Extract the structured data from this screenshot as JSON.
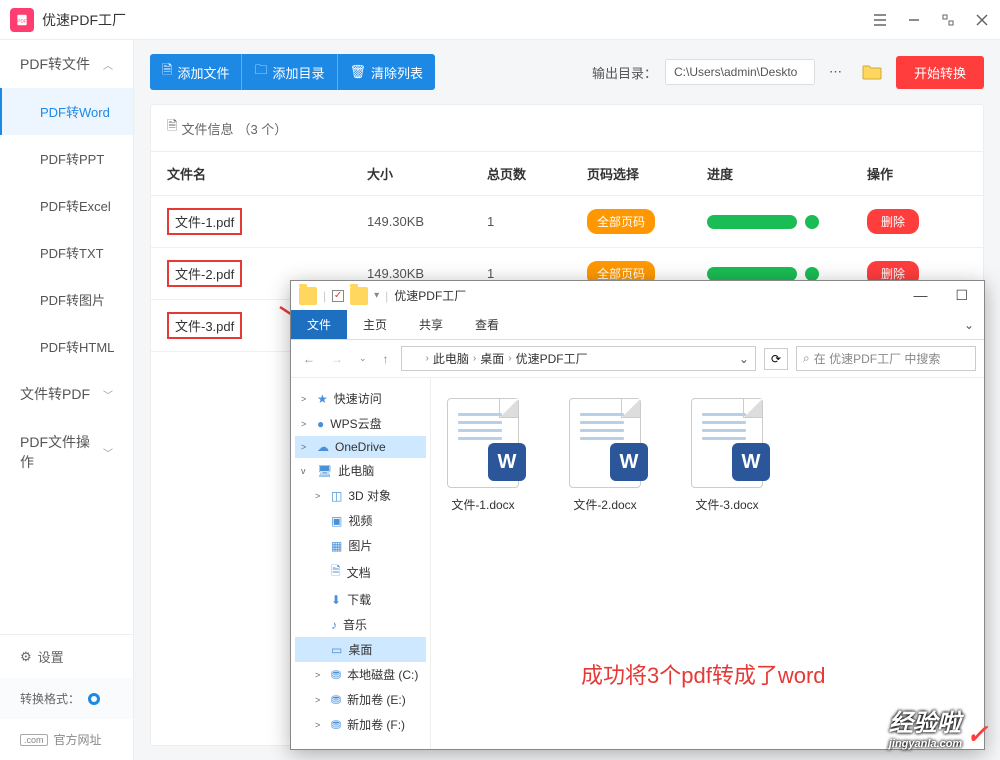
{
  "app": {
    "title": "优速PDF工厂"
  },
  "sidebar": {
    "groups": [
      {
        "label": "PDF转文件",
        "open": true,
        "items": [
          "PDF转Word",
          "PDF转PPT",
          "PDF转Excel",
          "PDF转TXT",
          "PDF转图片",
          "PDF转HTML"
        ]
      },
      {
        "label": "文件转PDF",
        "open": false
      },
      {
        "label": "PDF文件操作",
        "open": false
      }
    ],
    "settings": "设置",
    "format_label": "转换格式：",
    "official": "官方网址"
  },
  "toolbar": {
    "add_file": "添加文件",
    "add_dir": "添加目录",
    "clear": "清除列表",
    "out_label": "输出目录：",
    "out_path": "C:\\Users\\admin\\Deskto",
    "start": "开始转换"
  },
  "table": {
    "caption_prefix": "文件信息",
    "caption_count": "（3 个）",
    "headers": [
      "文件名",
      "大小",
      "总页数",
      "页码选择",
      "进度",
      "操作"
    ],
    "page_btn": "全部页码",
    "del_btn": "删除",
    "rows": [
      {
        "name": "文件-1.pdf",
        "size": "149.30KB",
        "pages": "1"
      },
      {
        "name": "文件-2.pdf",
        "size": "149.30KB",
        "pages": "1"
      },
      {
        "name": "文件-3.pdf",
        "size": "",
        "pages": ""
      }
    ]
  },
  "explorer": {
    "title": "优速PDF工厂",
    "ribbon": {
      "file": "文件",
      "home": "主页",
      "share": "共享",
      "view": "查看"
    },
    "breadcrumb": [
      "此电脑",
      "桌面",
      "优速PDF工厂"
    ],
    "search_placeholder": "在 优速PDF工厂 中搜索",
    "tree": [
      {
        "label": "快速访问",
        "caret": ">",
        "indent": 0,
        "icon": "star"
      },
      {
        "label": "WPS云盘",
        "caret": ">",
        "indent": 0,
        "icon": "wps"
      },
      {
        "label": "OneDrive",
        "caret": ">",
        "indent": 0,
        "icon": "onedrive",
        "sel": true
      },
      {
        "label": "此电脑",
        "caret": "v",
        "indent": 0,
        "icon": "pc"
      },
      {
        "label": "3D 对象",
        "caret": ">",
        "indent": 1,
        "icon": "3d"
      },
      {
        "label": "视频",
        "caret": "",
        "indent": 1,
        "icon": "video"
      },
      {
        "label": "图片",
        "caret": "",
        "indent": 1,
        "icon": "pic"
      },
      {
        "label": "文档",
        "caret": "",
        "indent": 1,
        "icon": "doc"
      },
      {
        "label": "下载",
        "caret": "",
        "indent": 1,
        "icon": "dl"
      },
      {
        "label": "音乐",
        "caret": "",
        "indent": 1,
        "icon": "music"
      },
      {
        "label": "桌面",
        "caret": "",
        "indent": 1,
        "icon": "desk",
        "sel": true
      },
      {
        "label": "本地磁盘 (C:)",
        "caret": ">",
        "indent": 1,
        "icon": "disk"
      },
      {
        "label": "新加卷 (E:)",
        "caret": ">",
        "indent": 1,
        "icon": "disk"
      },
      {
        "label": "新加卷 (F:)",
        "caret": ">",
        "indent": 1,
        "icon": "disk"
      }
    ],
    "files": [
      "文件-1.docx",
      "文件-2.docx",
      "文件-3.docx"
    ]
  },
  "annotation": "成功将3个pdf转成了word",
  "watermark": {
    "big": "经验啦",
    "small": "jingyanla.com"
  }
}
